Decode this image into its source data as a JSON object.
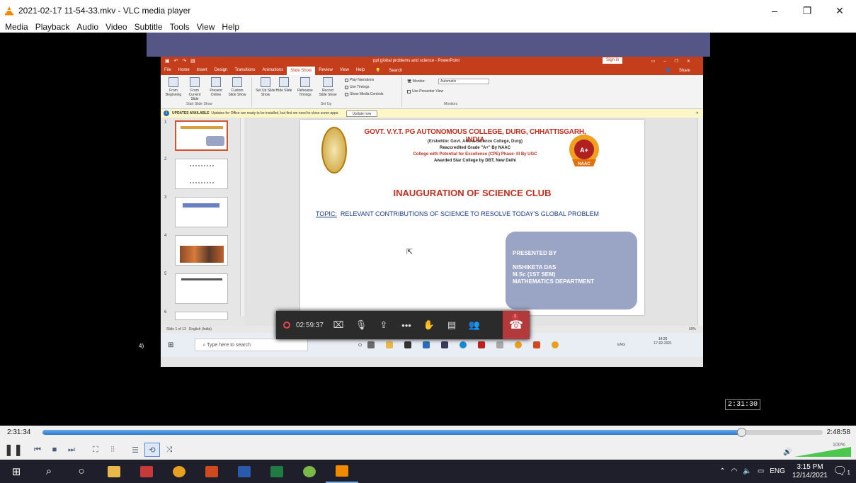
{
  "window": {
    "title": "2021-02-17 11-54-33.mkv - VLC media player",
    "menus": [
      "Media",
      "Playback",
      "Audio",
      "Video",
      "Subtitle",
      "Tools",
      "View",
      "Help"
    ],
    "minimize": "–",
    "restore": "❐",
    "close": "✕"
  },
  "powerpoint": {
    "doc_title": "ppt global problems and science - PowerPoint",
    "signin": "Sign in",
    "tabs": [
      "File",
      "Home",
      "Insert",
      "Design",
      "Transitions",
      "Animations",
      "Slide Show",
      "Review",
      "View",
      "Help",
      "Search"
    ],
    "active_tab": "Slide Show",
    "share": "Share",
    "ribbon": {
      "from_beginning": "From Beginning",
      "from_current": "From Current Slide",
      "present_online": "Present Online",
      "custom_show": "Custom Slide Show",
      "setup_show": "Set Up Slide Show",
      "hide_slide": "Hide Slide",
      "rehearse": "Rehearse Timings",
      "record": "Record Slide Show",
      "play_narrations": "Play Narrations",
      "use_timings": "Use Timings",
      "show_media": "Show Media Controls",
      "monitor_label": "Monitor:",
      "monitor_value": "Automatic",
      "presenter_view": "Use Presenter View",
      "group_start": "Start Slide Show",
      "group_setup": "Set Up",
      "group_monitors": "Monitors"
    },
    "notice": {
      "label": "UPDATES AVAILABLE",
      "text": "Updates for Office are ready to be installed, but first we need to close some apps.",
      "button": "Update now"
    },
    "thumb_numbers": [
      "1",
      "2",
      "3",
      "4",
      "5",
      "6"
    ],
    "slide": {
      "college": "GOVT. V.Y.T. PG AUTONOMOUS COLLEGE, DURG, CHHATTISGARH, INDIA",
      "line1": "(Erstwhile: Govt. Arts & Science College, Durg)",
      "line2": "Reaccredited Grade \"A+\" By NAAC",
      "line3": "College with Potential for Excellence (CPE) Phase- III By UGC",
      "line4": "Awarded Star College by DBT, New Delhi",
      "heading": "INAUGURATION OF SCIENCE CLUB",
      "topic_label": "TOPIC:",
      "topic_text": "RELEVANT CONTRIBUTIONS OF SCIENCE TO RESOLVE TODAY'S GLOBAL PROBLEM",
      "presented_by": "PRESENTED BY",
      "presenter_name": "NISHIKETA DAS",
      "presenter_course": "M.Sc (1ST SEM)",
      "presenter_dept": "MATHEMATICS DEPARTMENT",
      "badge_grade": "A+",
      "badge_org": "NAAC"
    },
    "status": {
      "slide_of": "Slide 1 of 13",
      "language": "English (India)",
      "zoom": "69%"
    },
    "inner_taskbar": {
      "search_placeholder": "Type here to search",
      "lang": "ENG",
      "time": "14:26",
      "date": "17-02-2021"
    }
  },
  "meeting": {
    "elapsed": "02:59:37",
    "badge": "1"
  },
  "side_label": "4)",
  "seek_tooltip": "2:31:30",
  "player": {
    "elapsed": "2:31:34",
    "total": "2:48:58",
    "progress": 0.896,
    "volume": "100%"
  },
  "taskbar": {
    "lang": "ENG",
    "time": "3:15 PM",
    "date": "12/14/2021",
    "notification_count": "1"
  },
  "colors": {
    "ppt_accent": "#c43e1c",
    "seek_fill": "#2e7bd1",
    "end_call": "#b33a3a"
  }
}
